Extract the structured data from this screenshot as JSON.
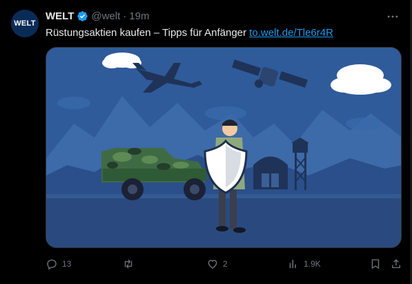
{
  "author": {
    "avatar_text": "WELT",
    "name": "WELT",
    "handle": "@welt",
    "separator": "·",
    "time": "19m"
  },
  "tweet": {
    "text": "Rüstungsaktien kaufen – Tipps für Anfänger ",
    "link": "to.welt.de/Tle6r4R"
  },
  "actions": {
    "replies": "13",
    "reposts": "",
    "likes": "2",
    "views": "1.9K"
  },
  "colors": {
    "background": "#000000",
    "text": "#e7e9ea",
    "muted": "#71767b",
    "link": "#1d9bf0",
    "verified": "#1d9bf0"
  },
  "icons": {
    "more": "more-icon",
    "reply": "reply-icon",
    "repost": "repost-icon",
    "like": "heart-icon",
    "views": "views-icon",
    "bookmark": "bookmark-icon",
    "share": "share-icon"
  }
}
